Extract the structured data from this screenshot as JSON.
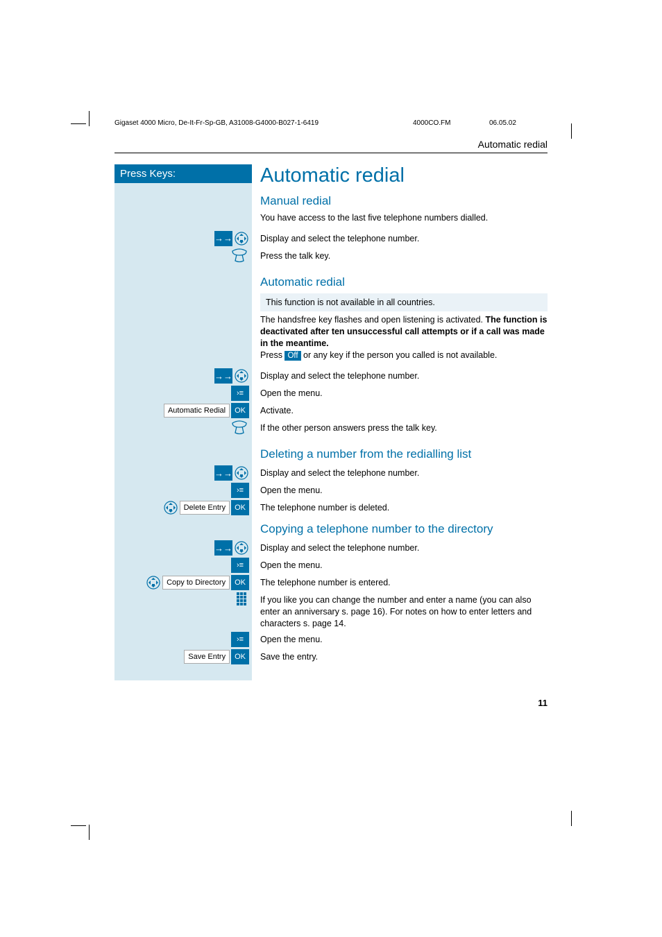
{
  "header": {
    "doc_id": "Gigaset 4000 Micro, De-It-Fr-Sp-GB, A31008-G4000-B027-1-6419",
    "file": "4000CO.FM",
    "date": "06.05.02"
  },
  "running_head": "Automatic redial",
  "left_header": "Press Keys:",
  "title": "Automatic redial",
  "sections": {
    "manual": {
      "heading": "Manual redial",
      "intro": "You have access to the last five telephone numbers dialled.",
      "steps": {
        "s1": "Display and select the telephone number.",
        "s2": "Press the talk key."
      }
    },
    "auto": {
      "heading": "Automatic redial",
      "note": "This function is not available in all countries.",
      "body_pre": "The handsfree key flashes and open listening is activated. ",
      "body_bold": "The function is deactivated after ten unsuccessful call attempts or if a call was made in the meantime.",
      "body_post_pre": "Press ",
      "body_off": "Off",
      "body_post": " or any key if the person you called is not available.",
      "steps": {
        "s1": "Display and select the telephone number.",
        "s2": "Open the menu.",
        "s3_label": "Automatic Redial",
        "s3": "Activate.",
        "s4": "If the other person answers press the talk key."
      }
    },
    "delete": {
      "heading": "Deleting a number from the redialling list",
      "steps": {
        "s1": "Display and select the telephone number.",
        "s2": "Open the menu.",
        "s3_label": "Delete Entry",
        "s3": "The telephone number is deleted."
      }
    },
    "copy": {
      "heading": "Copying a telephone number to the directory",
      "steps": {
        "s1": "Display and select the telephone number.",
        "s2": "Open the menu.",
        "s3_label": "Copy to Directory",
        "s3": "The telephone number is entered.",
        "s4": "If you like you can change the number and enter a name (you can also enter an anniversary s. page 16). For notes on how to enter letters and characters s. page 14.",
        "s5": "Open the menu.",
        "s6_label": "Save Entry",
        "s6": "Save the entry."
      }
    }
  },
  "ok_label": "OK",
  "page_number": "11"
}
